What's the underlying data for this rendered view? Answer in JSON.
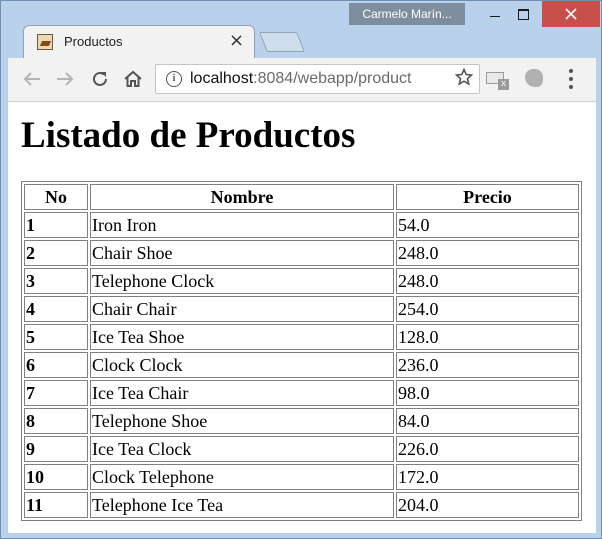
{
  "window": {
    "user": "Carmelo Marín..."
  },
  "tab": {
    "title": "Productos",
    "close_glyph": "×"
  },
  "address_bar": {
    "host": "localhost",
    "rest": ":8084/webapp/product"
  },
  "page": {
    "heading": "Listado de Productos",
    "columns": [
      "No",
      "Nombre",
      "Precio"
    ],
    "rows": [
      {
        "no": "1",
        "nombre": "Iron Iron",
        "precio": "54.0"
      },
      {
        "no": "2",
        "nombre": "Chair Shoe",
        "precio": "248.0"
      },
      {
        "no": "3",
        "nombre": "Telephone Clock",
        "precio": "248.0"
      },
      {
        "no": "4",
        "nombre": "Chair Chair",
        "precio": "254.0"
      },
      {
        "no": "5",
        "nombre": "Ice Tea Shoe",
        "precio": "128.0"
      },
      {
        "no": "6",
        "nombre": "Clock Clock",
        "precio": "236.0"
      },
      {
        "no": "7",
        "nombre": "Ice Tea Chair",
        "precio": "98.0"
      },
      {
        "no": "8",
        "nombre": "Telephone Shoe",
        "precio": "84.0"
      },
      {
        "no": "9",
        "nombre": "Ice Tea Clock",
        "precio": "226.0"
      },
      {
        "no": "10",
        "nombre": "Clock Telephone",
        "precio": "172.0"
      },
      {
        "no": "11",
        "nombre": "Telephone Ice Tea",
        "precio": "204.0"
      }
    ]
  },
  "icons": {
    "back": "arrow-left-icon",
    "forward": "arrow-right-icon",
    "reload": "reload-icon",
    "home": "home-icon",
    "info": "info-icon",
    "bookmark": "star-icon",
    "menu": "kebab-menu-icon"
  },
  "colors": {
    "frame": "#b9d1ea",
    "close_button": "#c7504c",
    "toolbar": "#f2f2f2"
  }
}
